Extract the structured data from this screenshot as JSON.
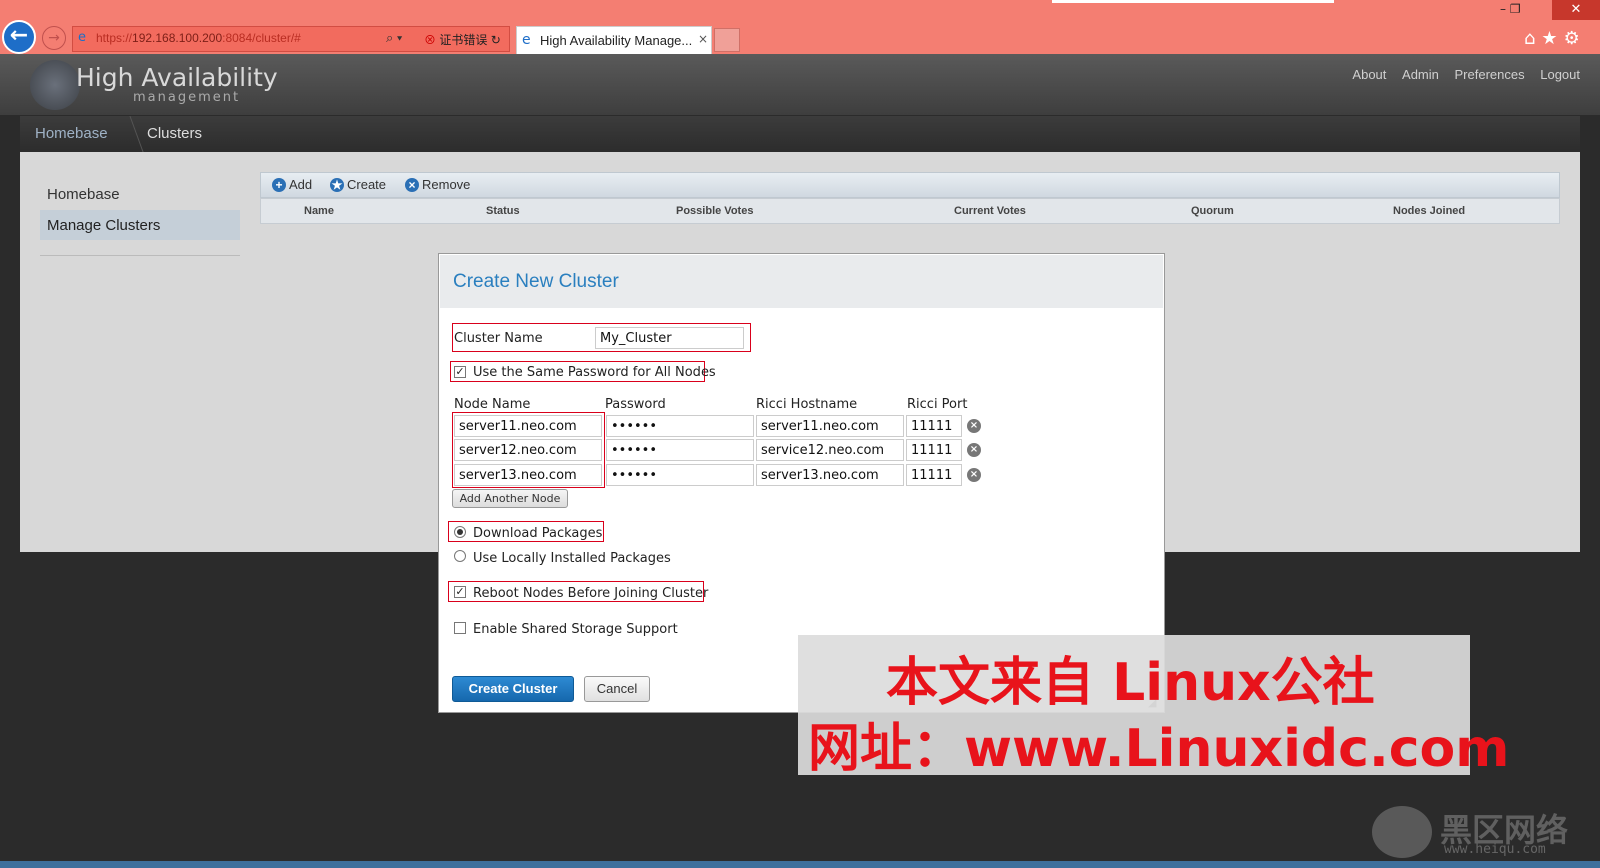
{
  "browser": {
    "url_prefix": "https://",
    "url_host": "192.168.100.200",
    "url_path": ":8084/cluster/#",
    "cert_error": "证书错误",
    "tab_title": "High Availability Manage...",
    "tab_close": "×",
    "search_glyph": "⌕ ▾",
    "back_glyph": "←",
    "forward_glyph": "→",
    "toolbar_glyphs": "⌂★⚙",
    "window_controls": "–   ❐",
    "window_close": "✕"
  },
  "app": {
    "title": "High Availability",
    "subtitle": "management",
    "nav": [
      "About",
      "Admin",
      "Preferences",
      "Logout"
    ]
  },
  "breadcrumb": {
    "home": "Homebase",
    "current": "Clusters"
  },
  "sidebar": {
    "items": [
      "Homebase",
      "Manage Clusters"
    ]
  },
  "grid": {
    "toolbar": [
      "Add",
      "Create",
      "Remove"
    ],
    "columns": [
      "Name",
      "Status",
      "Possible Votes",
      "Current Votes",
      "Quorum",
      "Nodes Joined"
    ]
  },
  "dialog": {
    "title": "Create New Cluster",
    "cluster_name_label": "Cluster Name",
    "cluster_name_value": "My_Cluster",
    "same_password_label": "Use the Same Password for All Nodes",
    "same_password_checked": true,
    "node_headers": [
      "Node Name",
      "Password",
      "Ricci Hostname",
      "Ricci Port"
    ],
    "nodes": [
      {
        "name": "server11.neo.com",
        "password": "••••••",
        "host": "server11.neo.com",
        "port": "11111"
      },
      {
        "name": "server12.neo.com",
        "password": "••••••",
        "host": "service12.neo.com",
        "port": "11111"
      },
      {
        "name": "server13.neo.com",
        "password": "••••••",
        "host": "server13.neo.com",
        "port": "11111"
      }
    ],
    "add_node_label": "Add Another Node",
    "download_label": "Download Packages",
    "local_label": "Use Locally Installed Packages",
    "reboot_label": "Reboot Nodes Before Joining Cluster",
    "shared_storage_label": "Enable Shared Storage Support",
    "create_label": "Create Cluster",
    "cancel_label": "Cancel"
  },
  "watermark": {
    "line1": "本文来自 Linux公社",
    "line2": "网址：www.Linuxidc.com",
    "brand": "黑区网络",
    "brand_url": "www.heiqu.com"
  },
  "colors": {
    "browser_chrome": "#f47e72",
    "accent_blue": "#2a7fbf",
    "highlight_red": "#d9001b"
  }
}
